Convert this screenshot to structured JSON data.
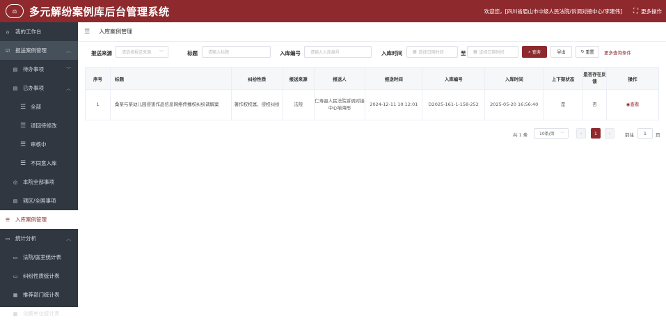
{
  "app": {
    "title": "多元解纷案例库后台管理系统",
    "logo": "法院"
  },
  "topbar": {
    "welcome": "欢迎您，[四川省眉山市中级人民法院/诉调对接中心/李建伟]",
    "more_ops": "更多操作"
  },
  "sidebar": {
    "workspace": "我的工作台",
    "submit_mgmt": "报送案例管理",
    "todo": "待办事项",
    "done": "已办事项",
    "all": "全部",
    "returned": "退回待修改",
    "reviewing": "审核中",
    "rejected": "不同意入库",
    "court_all": "本院全部事项",
    "region_all": "辖区/全国事项",
    "warehouse_mgmt": "入库案例管理",
    "stats": "统计分析",
    "stat_court": "法院/庭室统计表",
    "stat_nature": "纠纷性质统计表",
    "stat_dept": "推荐部门统计表",
    "stat_unit": "化解单位统计表"
  },
  "page": {
    "title": "入库案例管理"
  },
  "filters": {
    "source_label": "报送来源",
    "source_placeholder": "请选择报送来源",
    "title_label": "标题",
    "title_placeholder": "请输入标题",
    "code_label": "入库编号",
    "code_placeholder": "请输入入库编号",
    "time_label": "入库时间",
    "start_placeholder": "选择日期时间",
    "to": "至",
    "end_placeholder": "选择日期时间",
    "query": "查询",
    "export": "导出",
    "reset": "重置",
    "more": "更多查询条件"
  },
  "table": {
    "headers": [
      "序号",
      "标题",
      "纠纷性质",
      "报送来源",
      "报送人",
      "报送时间",
      "入库编号",
      "入库时间",
      "上下架状态",
      "是否存在反馈",
      "操作"
    ],
    "rows": [
      {
        "no": "1",
        "title": "桑某与某幼儿园侵害作品信息网络传播权纠纷调解案",
        "nature": "著作权权属、侵权纠纷",
        "source": "法院",
        "submitter": "仁寿县人民法院诉调对接中心喻海彤",
        "submit_time": "2024-12-11 10:12:01",
        "code": "D2025-161-1-158-252",
        "store_time": "2025-05-20 16:56:40",
        "status": "是",
        "feedback": "否",
        "action": "查看"
      }
    ]
  },
  "pager": {
    "total": "共 1 条",
    "size": "10条/页",
    "current": "1",
    "goto": "前往",
    "goto_value": "1",
    "page_unit": "页"
  },
  "colors": {
    "brand": "#8e2a2e",
    "sidebar": "#303740"
  }
}
